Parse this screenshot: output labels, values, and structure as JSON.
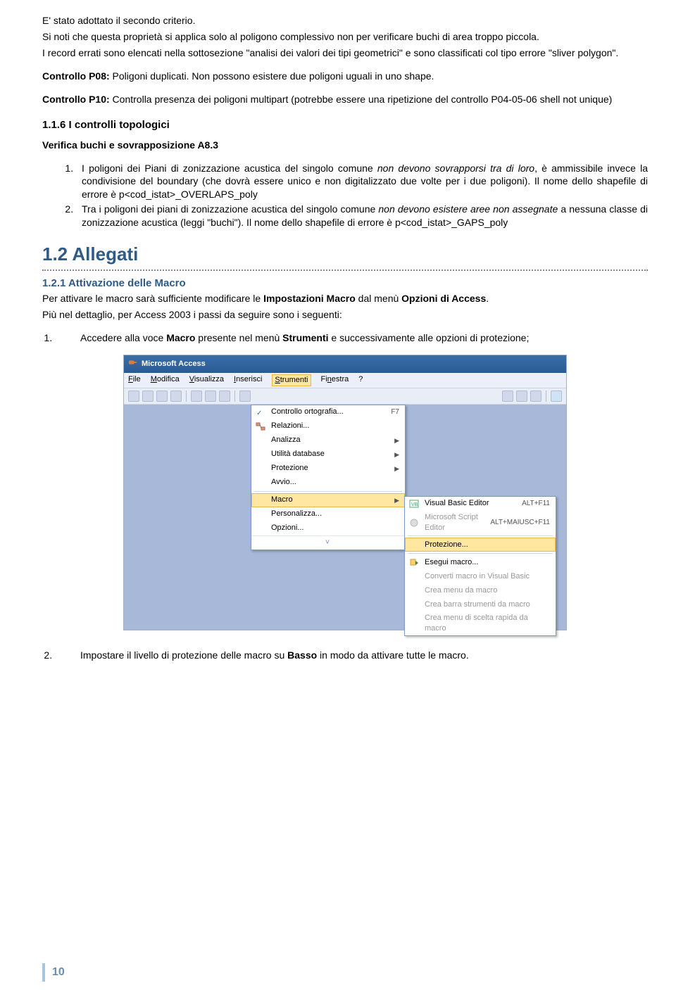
{
  "para1_line1": "E' stato adottato il secondo criterio.",
  "para1_line2": "Si noti che questa proprietà si applica solo al poligono complessivo non per verificare buchi di area troppo piccola.",
  "para1_line3": "I record errati sono elencati nella sottosezione \"analisi dei valori dei tipi geometrici\" e sono classificati col tipo errore \"sliver polygon\".",
  "p08_label": "Controllo P08:",
  "p08_text": " Poligoni duplicati. Non possono esistere due poligoni uguali in uno shape.",
  "p10_label": "Controllo P10:",
  "p10_text": " Controlla presenza dei poligoni multipart (potrebbe essere una ripetizione del controllo P04-05-06 shell not unique)",
  "h116": "1.1.6   I controlli topologici",
  "verifica": "Verifica buchi e sovrapposizione A8.3",
  "li1_a": "I poligoni dei Piani di zonizzazione acustica del singolo comune ",
  "li1_b": "non devono sovrapporsi tra di loro",
  "li1_c": ", è ammissibile invece la condivisione del boundary (che dovrà essere unico e non digitalizzato due volte per i due poligoni). Il nome dello shapefile di errore è p<cod_istat>_OVERLAPS_poly",
  "li2_a": "Tra i poligoni dei piani di zonizzazione acustica del singolo comune ",
  "li2_b": "non devono esistere aree non assegnate",
  "li2_c": " a nessuna classe di zonizzazione acustica (leggi \"buchi\"). Il nome dello shapefile di errore è p<cod_istat>_GAPS_poly",
  "h12": "1.2 Allegati",
  "h121": "1.2.1   Attivazione delle Macro",
  "macro1_a": "Per attivare le macro sarà sufficiente modificare le ",
  "macro1_b": "Impostazioni Macro",
  "macro1_c": " dal menù ",
  "macro1_d": "Opzioni di Access",
  "macro1_e": ".",
  "macro2": "Più nel dettaglio, per Access 2003 i passi da seguire sono i seguenti:",
  "step1_a": "Accedere alla voce ",
  "step1_b": "Macro",
  "step1_c": " presente nel menù ",
  "step1_d": "Strumenti",
  "step1_e": " e successivamente alle opzioni di protezione;",
  "step2_a": "Impostare il livello di protezione delle macro su ",
  "step2_b": "Basso",
  "step2_c": " in modo da attivare tutte le macro.",
  "fig": {
    "title": "Microsoft Access",
    "menu": {
      "file": "File",
      "modifica": "Modifica",
      "visualizza": "Visualizza",
      "inserisci": "Inserisci",
      "strumenti": "Strumenti",
      "finestra": "Finestra",
      "help": "?"
    },
    "m1": {
      "ortografia": "Controllo ortografia...",
      "ortografia_key": "F7",
      "relazioni": "Relazioni...",
      "analizza": "Analizza",
      "utilita": "Utilità database",
      "protezione": "Protezione",
      "avvio": "Avvio...",
      "macro": "Macro",
      "personalizza": "Personalizza...",
      "opzioni": "Opzioni..."
    },
    "m2": {
      "vbe": "Visual Basic Editor",
      "vbe_key": "ALT+F11",
      "mse": "Microsoft Script Editor",
      "mse_key": "ALT+MAIUSC+F11",
      "prot": "Protezione...",
      "esegui": "Esegui macro...",
      "converti": "Converti macro in Visual Basic",
      "menu": "Crea menu da macro",
      "barra": "Crea barra strumenti da macro",
      "scelta": "Crea menu di scelta rapida da macro"
    }
  },
  "page_number": "10"
}
